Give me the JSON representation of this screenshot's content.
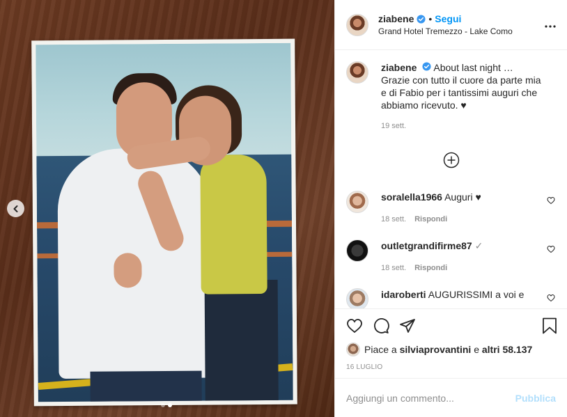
{
  "post": {
    "media": {
      "image_alt": "photo-print-on-wooden-table",
      "dots": [
        {
          "active": false
        },
        {
          "active": true
        }
      ]
    },
    "header": {
      "username": "ziabene",
      "separator": "•",
      "follow_label": "Segui",
      "location": "Grand Hotel Tremezzo - Lake Como",
      "more_label": "•••"
    },
    "caption": {
      "username": "ziabene",
      "text": "About last night … Grazie con tutto il cuore da parte mia e di Fabio per i tantissimi auguri che abbiamo ricevuto. ♥",
      "time": "19 sett."
    },
    "comments": [
      {
        "username": "soralella1966",
        "text": "Auguri ♥",
        "time": "18 sett.",
        "reply_label": "Rispondi"
      },
      {
        "username": "outletgrandifirme87",
        "text": "✓",
        "time": "18 sett.",
        "reply_label": "Rispondi"
      },
      {
        "username": "idaroberti",
        "text": "AUGURISSIMI a voi e",
        "time": "",
        "reply_label": ""
      }
    ],
    "likes": {
      "prefix": "Piace a ",
      "user": "silviaprovantini",
      "middle": " e ",
      "others": "altri 58.137"
    },
    "date": "16 LUGLIO",
    "add_comment": {
      "placeholder": "Aggiungi un commento...",
      "publish_label": "Pubblica"
    },
    "colors": {
      "accent": "#0095f6",
      "publish_disabled": "#b2dffc",
      "muted": "#8e8e8e"
    }
  }
}
